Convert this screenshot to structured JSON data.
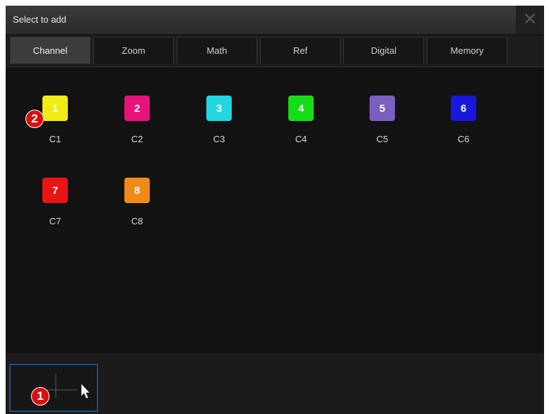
{
  "dialog": {
    "title": "Select to add",
    "close_label": "✕"
  },
  "tabs": [
    {
      "label": "Channel",
      "active": true
    },
    {
      "label": "Zoom",
      "active": false
    },
    {
      "label": "Math",
      "active": false
    },
    {
      "label": "Ref",
      "active": false
    },
    {
      "label": "Digital",
      "active": false
    },
    {
      "label": "Memory",
      "active": false
    }
  ],
  "channels": [
    {
      "number": "1",
      "label": "C1",
      "color": "#f2ec15"
    },
    {
      "number": "2",
      "label": "C2",
      "color": "#e8127a"
    },
    {
      "number": "3",
      "label": "C3",
      "color": "#22d6e2"
    },
    {
      "number": "4",
      "label": "C4",
      "color": "#16dc16"
    },
    {
      "number": "5",
      "label": "C5",
      "color": "#7a5ec0"
    },
    {
      "number": "6",
      "label": "C6",
      "color": "#1717dd"
    },
    {
      "number": "7",
      "label": "C7",
      "color": "#ea1414"
    },
    {
      "number": "8",
      "label": "C8",
      "color": "#f08a18"
    }
  ],
  "callouts": {
    "one": "1",
    "two": "2"
  },
  "cursor_tool": {
    "icon": "crosshair-pointer-icon"
  }
}
